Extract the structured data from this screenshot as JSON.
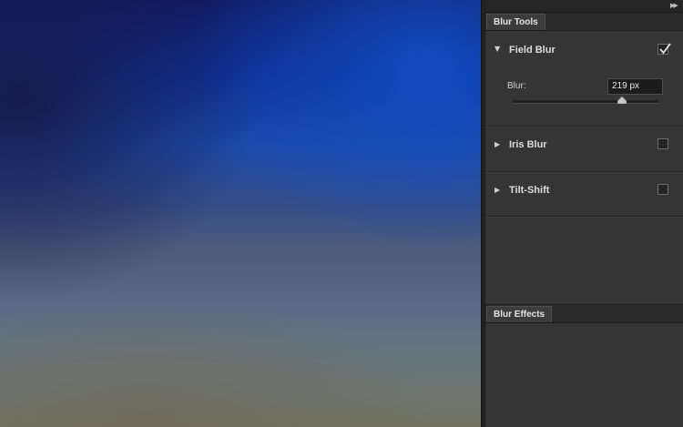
{
  "panel": {
    "collapse_icon": "double-chevron-right-icon",
    "blur_tools_tab": "Blur Tools",
    "blur_effects_tab": "Blur Effects",
    "sections": [
      {
        "label": "Field Blur",
        "expanded": true,
        "checked": true
      },
      {
        "label": "Iris Blur",
        "expanded": false,
        "checked": false
      },
      {
        "label": "Tilt-Shift",
        "expanded": false,
        "checked": false
      }
    ],
    "field_blur": {
      "blur_label": "Blur:",
      "blur_value": "219 px",
      "slider_fraction": 0.75
    }
  },
  "colors": {
    "panel_bg": "#353535",
    "panel_dark": "#262626",
    "canvas_top": "#101b62",
    "canvas_mid": "#1c4aa9",
    "canvas_bottom": "#72735f"
  }
}
